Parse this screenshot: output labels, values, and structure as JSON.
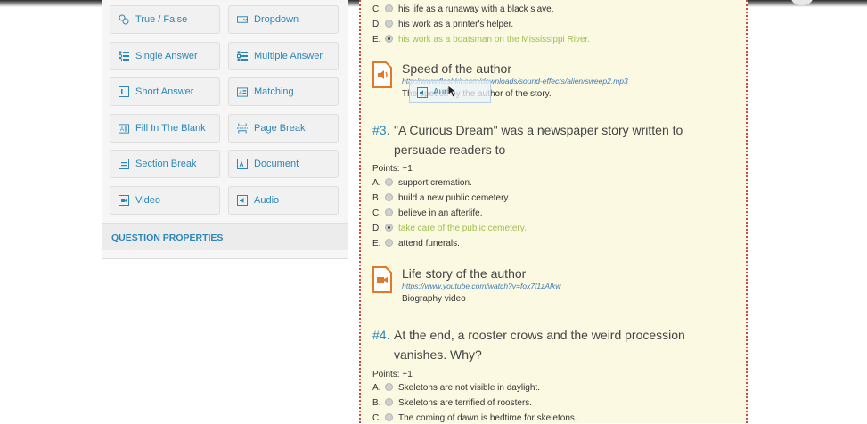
{
  "toolbox": {
    "items": [
      {
        "label": "True / False",
        "icon": "true-false-icon"
      },
      {
        "label": "Dropdown",
        "icon": "dropdown-icon"
      },
      {
        "label": "Single Answer",
        "icon": "single-answer-icon"
      },
      {
        "label": "Multiple Answer",
        "icon": "multiple-answer-icon"
      },
      {
        "label": "Short Answer",
        "icon": "short-answer-icon"
      },
      {
        "label": "Matching",
        "icon": "matching-icon"
      },
      {
        "label": "Fill In The Blank",
        "icon": "fill-blank-icon"
      },
      {
        "label": "Page Break",
        "icon": "page-break-icon"
      },
      {
        "label": "Section Break",
        "icon": "section-break-icon"
      },
      {
        "label": "Document",
        "icon": "document-icon"
      },
      {
        "label": "Video",
        "icon": "video-icon"
      },
      {
        "label": "Audio",
        "icon": "audio-icon"
      }
    ],
    "question_properties": "QUESTION PROPERTIES"
  },
  "q2_options": [
    {
      "letter": "C.",
      "text": "his life as a runaway with a black slave.",
      "selected": false,
      "correct": false
    },
    {
      "letter": "D.",
      "text": "his work as a printer's helper.",
      "selected": false,
      "correct": false
    },
    {
      "letter": "E.",
      "text": "his work as a boatsman on the Mississippi River.",
      "selected": true,
      "correct": true
    }
  ],
  "audio_media": {
    "title": "Speed of the author",
    "url": "http://www.flashkit.com/downloads/sound-effects/alien/sweep2.mp3",
    "description": "The speech by the author of the story.",
    "icon": "audio-file-icon",
    "drag_ghost_label": "Audio"
  },
  "q3": {
    "number": "#3.",
    "text": "\"A Curious Dream\" was a newspaper story written to persuade readers to",
    "points": "Points: +1",
    "options": [
      {
        "letter": "A.",
        "text": "support cremation.",
        "selected": false,
        "correct": false
      },
      {
        "letter": "B.",
        "text": "build a new public cemetery.",
        "selected": false,
        "correct": false
      },
      {
        "letter": "C.",
        "text": "believe in an afterlife.",
        "selected": false,
        "correct": false
      },
      {
        "letter": "D.",
        "text": "take care of the public cemetery.",
        "selected": true,
        "correct": true
      },
      {
        "letter": "E.",
        "text": "attend funerals.",
        "selected": false,
        "correct": false
      }
    ]
  },
  "video_media": {
    "title": "Life story of the author",
    "url": "https://www.youtube.com/watch?v=fox7f1zAlkw",
    "description": "Biography video",
    "icon": "video-file-icon"
  },
  "q4": {
    "number": "#4.",
    "text": "At the end, a rooster crows and the weird procession vanishes. Why?",
    "points": "Points: +1",
    "options": [
      {
        "letter": "A.",
        "text": "Skeletons are not visible in daylight.",
        "selected": false,
        "correct": false
      },
      {
        "letter": "B.",
        "text": "Skeletons are terrified of roosters.",
        "selected": false,
        "correct": false
      },
      {
        "letter": "C.",
        "text": "The coming of dawn is bedtime for skeletons.",
        "selected": false,
        "correct": false
      }
    ]
  },
  "colors": {
    "accent": "#2c86b8",
    "correct": "#9fbf4e",
    "media_icon": "#e07a2a",
    "doc_bg": "#fbf9e1",
    "doc_border": "#c94a4a"
  }
}
